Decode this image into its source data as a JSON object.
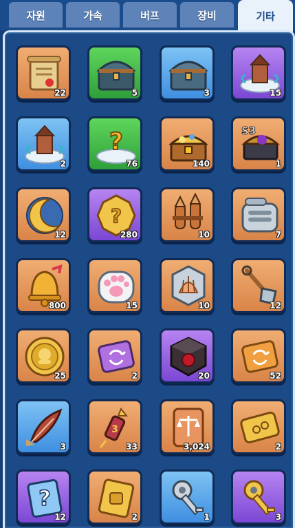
{
  "tabs": [
    {
      "label": "자원",
      "active": false
    },
    {
      "label": "가속",
      "active": false
    },
    {
      "label": "버프",
      "active": false
    },
    {
      "label": "장비",
      "active": false
    },
    {
      "label": "기타",
      "active": true
    }
  ],
  "items": [
    {
      "name": "scroll",
      "rarity": "orange",
      "count": "22",
      "icon": "scroll-icon"
    },
    {
      "name": "green-chest",
      "rarity": "green",
      "count": "5",
      "icon": "chest-icon"
    },
    {
      "name": "blue-chest",
      "rarity": "blue",
      "count": "3",
      "icon": "chest-icon"
    },
    {
      "name": "building-relocate-purple",
      "rarity": "purple",
      "count": "15",
      "icon": "building-icon"
    },
    {
      "name": "building-relocate-blue",
      "rarity": "blue",
      "count": "2",
      "icon": "building-icon"
    },
    {
      "name": "random-relocate",
      "rarity": "green",
      "count": "76",
      "icon": "question-platform-icon"
    },
    {
      "name": "treasure-chest",
      "rarity": "orange",
      "count": "140",
      "icon": "treasure-icon"
    },
    {
      "name": "s3-chest",
      "rarity": "orange",
      "count": "1",
      "icon": "s3-chest-icon"
    },
    {
      "name": "moon-badge",
      "rarity": "orange",
      "count": "12",
      "icon": "moon-icon"
    },
    {
      "name": "star-medal",
      "rarity": "purple",
      "count": "280",
      "icon": "gold-medal-icon"
    },
    {
      "name": "rocket-bundle",
      "rarity": "orange",
      "count": "10",
      "icon": "rocket-icon"
    },
    {
      "name": "sardine-can",
      "rarity": "orange",
      "count": "7",
      "icon": "can-icon"
    },
    {
      "name": "bell",
      "rarity": "orange",
      "count": "800",
      "icon": "bell-icon"
    },
    {
      "name": "paw-token",
      "rarity": "orange",
      "count": "15",
      "icon": "paw-icon"
    },
    {
      "name": "shell-token",
      "rarity": "orange",
      "count": "10",
      "icon": "shell-icon"
    },
    {
      "name": "shovel",
      "rarity": "orange",
      "count": "12",
      "icon": "shovel-icon"
    },
    {
      "name": "gold-coin",
      "rarity": "orange",
      "count": "25",
      "icon": "coin-icon"
    },
    {
      "name": "refresh-ticket",
      "rarity": "orange",
      "count": "2",
      "icon": "ticket-icon"
    },
    {
      "name": "dark-cube",
      "rarity": "purple",
      "count": "20",
      "icon": "cube-icon"
    },
    {
      "name": "pass-ticket",
      "rarity": "orange",
      "count": "52",
      "icon": "ticket-icon"
    },
    {
      "name": "feather-pen",
      "rarity": "blue",
      "count": "3",
      "icon": "feather-icon"
    },
    {
      "name": "firework",
      "rarity": "orange",
      "count": "33",
      "icon": "firework-icon"
    },
    {
      "name": "scale-ticket",
      "rarity": "orange",
      "count": "3,024",
      "icon": "scale-ticket-icon"
    },
    {
      "name": "gold-ticket",
      "rarity": "orange",
      "count": "2",
      "icon": "gold-ticket-icon"
    },
    {
      "name": "mystery-card",
      "rarity": "purple",
      "count": "12",
      "icon": "question-card-icon"
    },
    {
      "name": "gold-card",
      "rarity": "orange",
      "count": "2",
      "icon": "card-icon"
    },
    {
      "name": "silver-key",
      "rarity": "blue",
      "count": "1",
      "icon": "key-icon"
    },
    {
      "name": "gold-key",
      "rarity": "purple",
      "count": "3",
      "icon": "key-icon"
    }
  ]
}
